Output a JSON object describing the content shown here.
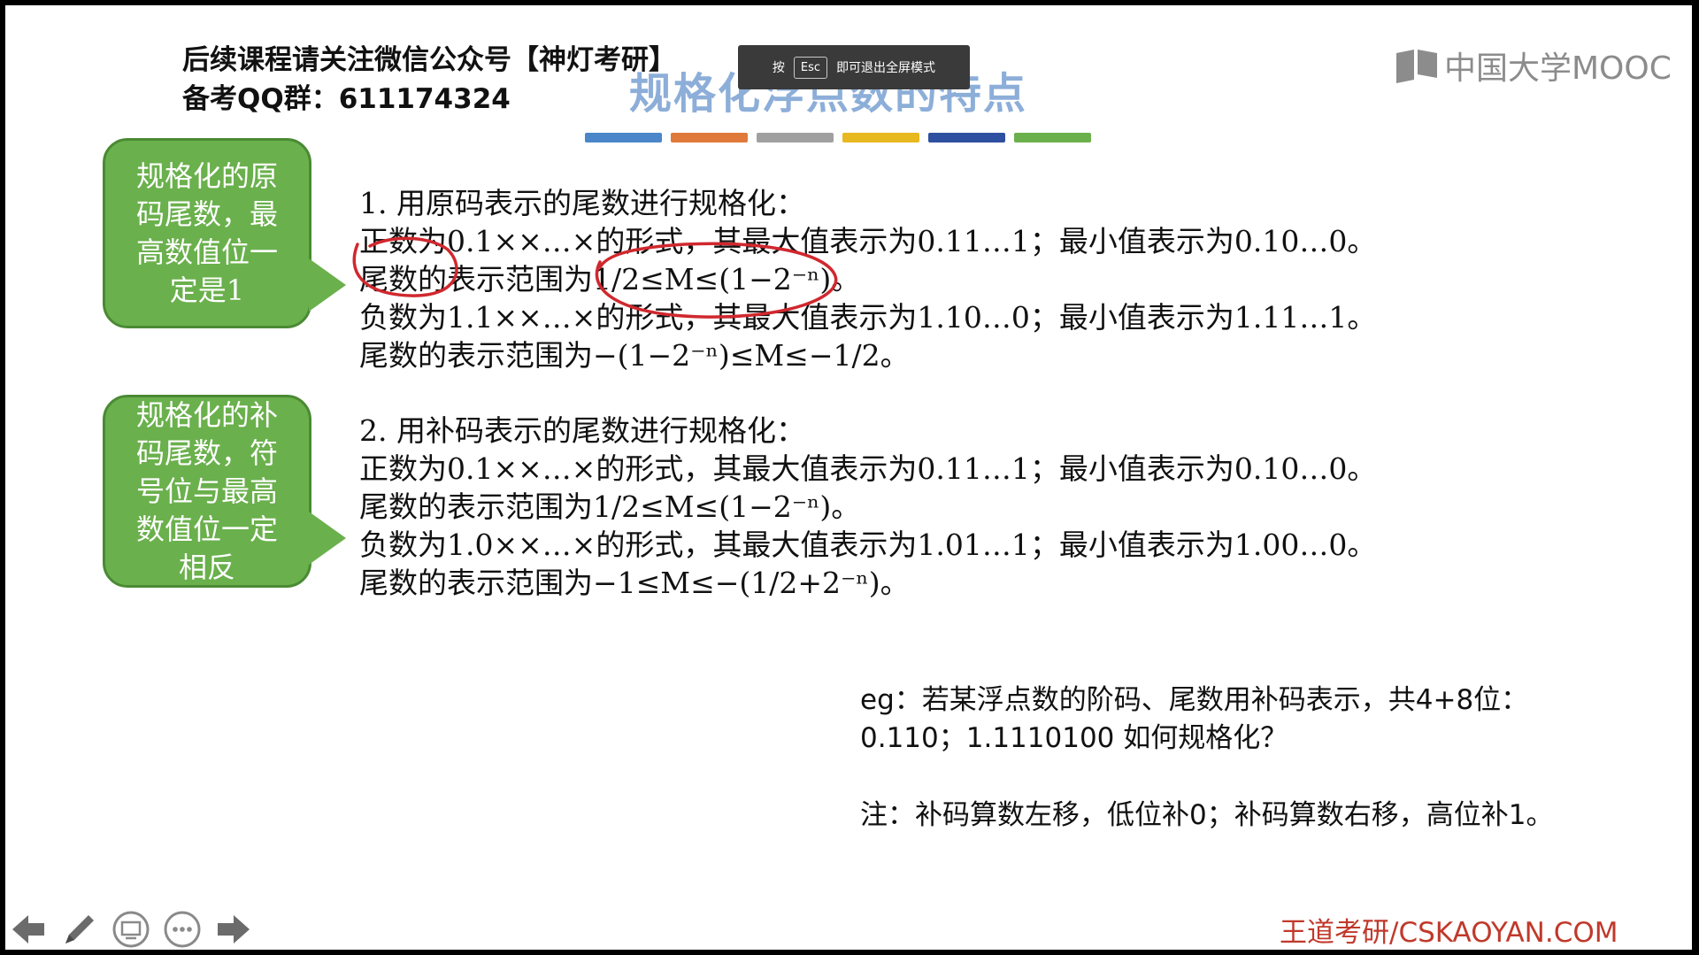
{
  "header": {
    "follow_notice": "后续课程请关注微信公众号【神灯考研】",
    "qq_group": "备考QQ群：611174324",
    "slide_title": "规格化浮点数的特点"
  },
  "fullscreen_hint": {
    "press": "按",
    "key": "Esc",
    "message": "即可退出全屏模式"
  },
  "logo": {
    "text": "中国大学MOOC",
    "icon": "mooc-book-icon"
  },
  "color_bar": [
    "#4a86c8",
    "#e07a3a",
    "#a0a0a0",
    "#e8b820",
    "#2f4fa0",
    "#6ab04c"
  ],
  "callouts": [
    {
      "lines": [
        "规格化的原",
        "码尾数，最",
        "高数值位一",
        "定是1"
      ]
    },
    {
      "lines": [
        "规格化的补",
        "码尾数，符",
        "号位与最高",
        "数值位一定",
        "相反"
      ]
    }
  ],
  "section1": {
    "heading": "1. 用原码表示的尾数进行规格化：",
    "lines": [
      "正数为0.1××…×的形式，其最大值表示为0.11…1；最小值表示为0.10…0。",
      "尾数的表示范围为1/2≤M≤(1−2⁻ⁿ)。",
      "负数为1.1××…×的形式，其最大值表示为1.10…0；最小值表示为1.11…1。",
      "尾数的表示范围为−(1−2⁻ⁿ)≤M≤−1/2。"
    ]
  },
  "section2": {
    "heading": "2. 用补码表示的尾数进行规格化：",
    "lines": [
      "正数为0.1××…×的形式，其最大值表示为0.11…1；最小值表示为0.10…0。",
      "尾数的表示范围为1/2≤M≤(1−2⁻ⁿ)。",
      "负数为1.0××…×的形式，其最大值表示为1.01…1；最小值表示为1.00…0。",
      "尾数的表示范围为−1≤M≤−(1/2+2⁻ⁿ)。"
    ]
  },
  "example": {
    "line1": "eg：若某浮点数的阶码、尾数用补码表示，共4+8位：",
    "line2": "0.110；1.1110100 如何规格化？"
  },
  "note": "注：补码算数左移，低位补0；补码算数右移，高位补1。",
  "footer_brand": "王道考研/CSKAOYAN.COM",
  "toolbar": {
    "buttons": [
      "prev-arrow-icon",
      "pen-icon",
      "screen-icon",
      "more-icon",
      "next-arrow-icon"
    ]
  },
  "annotation_color": "#d0282e"
}
